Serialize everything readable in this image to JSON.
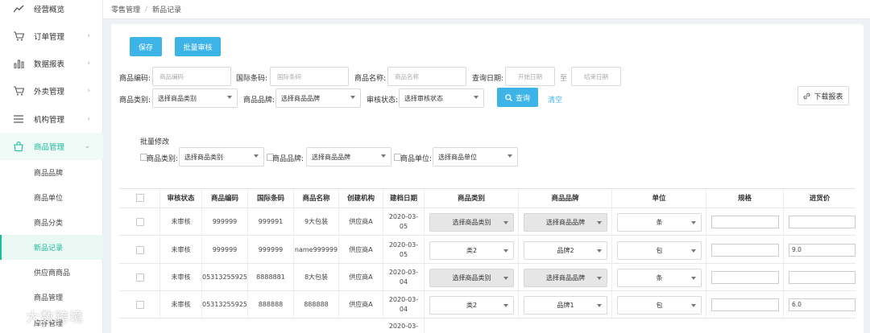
{
  "sidebar": {
    "items": [
      {
        "label": "经营概览",
        "icon": "trend-line-icon",
        "chevron": ""
      },
      {
        "label": "订单管理",
        "icon": "cart-icon",
        "chevron": "›"
      },
      {
        "label": "数据报表",
        "icon": "bar-chart-icon",
        "chevron": "›"
      },
      {
        "label": "外卖管理",
        "icon": "cart-icon",
        "chevron": "›"
      },
      {
        "label": "机构管理",
        "icon": "menu-icon",
        "chevron": "›"
      },
      {
        "label": "商品管理",
        "icon": "bag-icon",
        "chevron": "⌄"
      }
    ],
    "sub_items": [
      "商品品牌",
      "商品单位",
      "商品分类",
      "新品记录",
      "供应商商品",
      "商品管理",
      "库存管理"
    ],
    "selected_sub": "新品记录",
    "accent": "#1abc9c"
  },
  "watermark": "大数跨境",
  "breadcrumb": {
    "parent": "零售管理",
    "separator": "/",
    "current": "新品记录"
  },
  "toolbar": {
    "save": "保存",
    "batch_review": "批量审核"
  },
  "filters": {
    "code_label": "商品编码:",
    "code_placeholder": "商品编码",
    "intl_label": "国际条码:",
    "intl_placeholder": "国际条码",
    "name_label": "商品名称:",
    "name_placeholder": "商品名称",
    "date_label": "查询日期:",
    "date_start": "开始日期",
    "date_to": "至",
    "date_end": "结束日期",
    "category_label": "商品类别:",
    "category_value": "选择商品类别",
    "brand_label": "商品品牌:",
    "brand_value": "选择商品品牌",
    "status_label": "审核状态:",
    "status_value": "选择审核状态",
    "search": "查询",
    "clear": "清空",
    "download": "下载报表"
  },
  "batch": {
    "title": "批量修改",
    "category_label": "商品类别:",
    "category_value": "选择商品类别",
    "brand_label": "商品品牌:",
    "brand_value": "选择商品品牌",
    "unit_label": "商品单位:",
    "unit_value": "选择商品单位"
  },
  "table": {
    "headers": [
      "审核状态",
      "商品编码",
      "国际条码",
      "商品名称",
      "创建机构",
      "建档日期",
      "商品类别",
      "商品品牌",
      "单位",
      "规格",
      "进货价"
    ],
    "rows": [
      {
        "status": "未审核",
        "code": "999999",
        "barcode": "999991",
        "name": "9大包装",
        "org": "供应商A",
        "date": "2020-03-05",
        "category": "选择商品类别",
        "brand": "选择商品品牌",
        "unit": "条",
        "spec": "",
        "price": "",
        "gray": true
      },
      {
        "status": "未审核",
        "code": "999999",
        "barcode": "999999",
        "name": "name999999",
        "org": "供应商A",
        "date": "2020-03-05",
        "category": "类2",
        "brand": "品牌2",
        "unit": "包",
        "spec": "",
        "price": "9.0",
        "gray": false
      },
      {
        "status": "未审核",
        "code": "05313255925",
        "barcode": "8888881",
        "name": "8大包装",
        "org": "供应商A",
        "date": "2020-03-04",
        "category": "选择商品类别",
        "brand": "选择商品品牌",
        "unit": "条",
        "spec": "",
        "price": "",
        "gray": true
      },
      {
        "status": "未审核",
        "code": "05313255925",
        "barcode": "888888",
        "name": "888888",
        "org": "供应商A",
        "date": "2020-03-04",
        "category": "类2",
        "brand": "品牌1",
        "unit": "包",
        "spec": "",
        "price": "6.0",
        "gray": false
      }
    ],
    "partial_row_date": "2020-03-"
  }
}
